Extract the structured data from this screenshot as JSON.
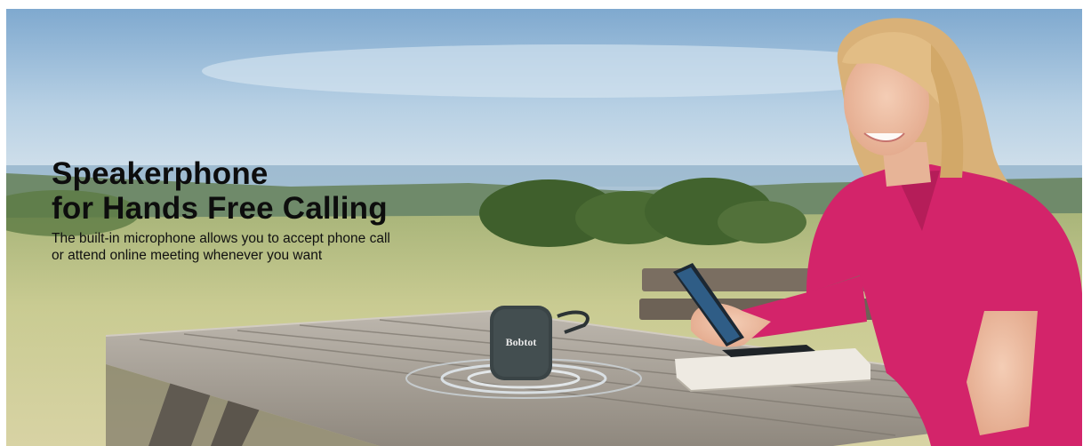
{
  "banner": {
    "headline_line1": "Speakerphone",
    "headline_line2": "for Hands Free Calling",
    "body_line1": "The built-in microphone allows you to accept phone call",
    "body_line2": "or attend online meeting whenever you want"
  },
  "product": {
    "brand": "Bobtot"
  },
  "colors": {
    "sky": "#b9d2e6",
    "grass": "#bfc48a",
    "table": "#a9a39a",
    "shirt": "#d3246a",
    "speaker": "#3a4446"
  }
}
